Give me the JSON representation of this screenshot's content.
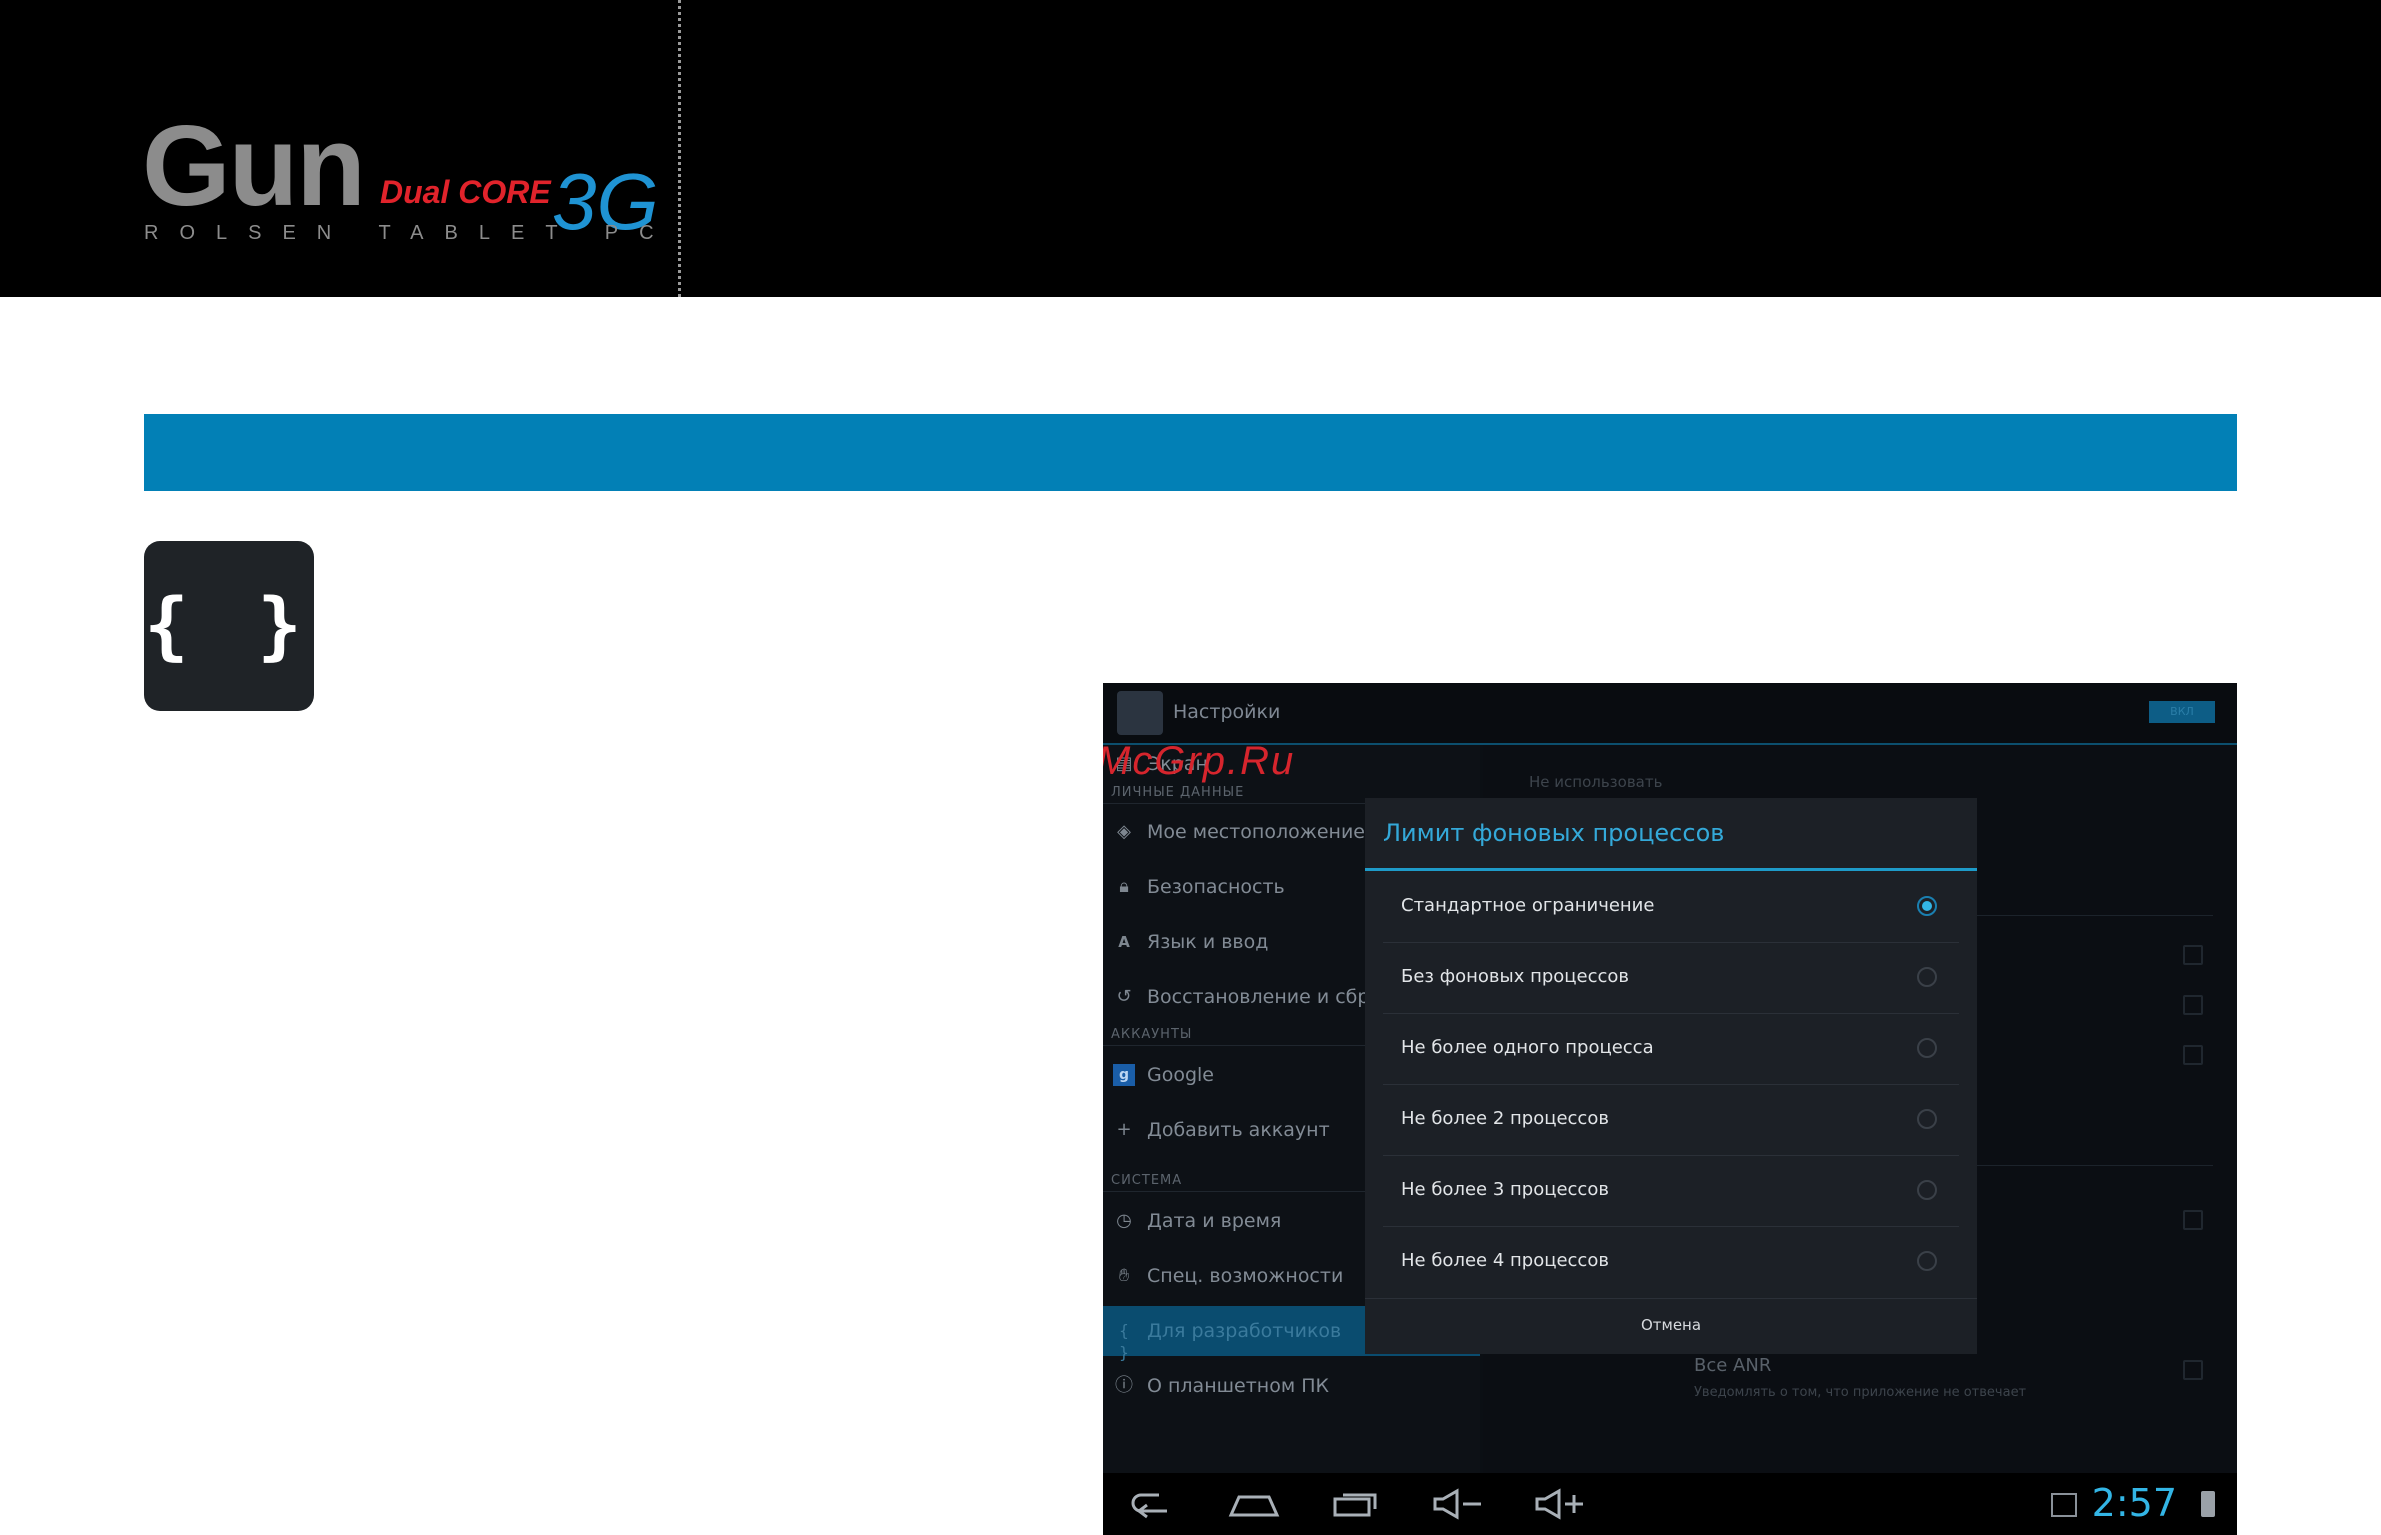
{
  "header": {
    "brand_name": "Gun",
    "brand_model": "Dual CORE",
    "brand_network": "3G",
    "brand_tagline": "ROLSEN TABLET PC"
  },
  "dev_icon_glyph": "{ }",
  "screenshot": {
    "action_bar": {
      "title": "Настройки",
      "toggle_label": "ВКЛ"
    },
    "watermark": "McGrp.Ru",
    "sidebar": {
      "top_item": "Экран",
      "categories": {
        "personal": "ЛИЧНЫЕ ДАННЫЕ",
        "accounts": "АККАУНТЫ",
        "system": "СИСТЕМА"
      },
      "personal_items": [
        {
          "label": "Мое местоположение",
          "icon": "location-icon"
        },
        {
          "label": "Безопасность",
          "icon": "lock-icon"
        },
        {
          "label": "Язык и ввод",
          "icon": "language-icon"
        },
        {
          "label": "Восстановление и сброс",
          "icon": "restore-icon"
        }
      ],
      "account_items": [
        {
          "label": "Google",
          "icon": "google-icon"
        },
        {
          "label": "Добавить аккаунт",
          "icon": "plus-icon"
        }
      ],
      "system_items": [
        {
          "label": "Дата и время",
          "icon": "clock-icon"
        },
        {
          "label": "Спец. возможности",
          "icon": "hand-icon"
        },
        {
          "label": "Для разработчиков",
          "icon": "braces-icon",
          "active": true
        },
        {
          "label": "О планшетном ПК",
          "icon": "info-icon"
        }
      ]
    },
    "right_pane": {
      "top_hint": "Не использовать",
      "anr_title": "Все ANR",
      "anr_subtitle": "Уведомлять о том, что приложение не отвечает"
    },
    "dialog": {
      "title": "Лимит фоновых процессов",
      "options": [
        {
          "label": "Стандартное ограничение",
          "selected": true
        },
        {
          "label": "Без фоновых процессов",
          "selected": false
        },
        {
          "label": "Не более одного процесса",
          "selected": false
        },
        {
          "label": "Не более 2 процессов",
          "selected": false
        },
        {
          "label": "Не более 3 процессов",
          "selected": false
        },
        {
          "label": "Не более 4 процессов",
          "selected": false
        }
      ],
      "cancel_label": "Отмена"
    },
    "navbar": {
      "buttons": [
        "back-icon",
        "home-icon",
        "recent-apps-icon",
        "volume-down-icon",
        "volume-up-icon"
      ],
      "clock": "2:57"
    }
  },
  "colors": {
    "section_bar": "#0280b6",
    "accent": "#33b5e5",
    "brand_red": "#e1232b",
    "brand_blue": "#1f93d3"
  }
}
